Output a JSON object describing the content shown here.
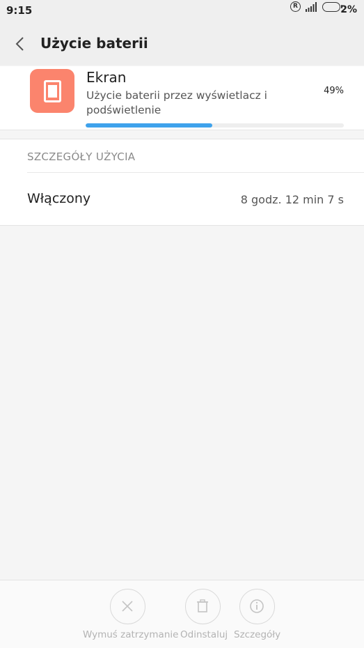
{
  "status_bar": {
    "time": "9:15",
    "registered_mark": "R",
    "battery_percent": "2%"
  },
  "action_bar": {
    "title": "Użycie baterii",
    "back_icon": "chevron-left-icon"
  },
  "app_card": {
    "name": "Ekran",
    "description": "Użycie baterii przez wyświetlacz i podświetlenie",
    "percent_label": "49%",
    "usage_fraction": 0.49,
    "icon": "phone-screen-icon",
    "icon_color": "#fb846d",
    "progress_color": "#3ea2ec"
  },
  "details": {
    "header": "SZCZEGÓŁY UŻYCIA",
    "rows": [
      {
        "label": "Włączony",
        "value": "8 godz. 12 min 7 s"
      }
    ]
  },
  "bottom_actions": [
    {
      "label": "Wymuś zatrzymanie",
      "icon": "close-icon"
    },
    {
      "label": "Odinstaluj",
      "icon": "trash-icon"
    },
    {
      "label": "Szczegóły",
      "icon": "info-icon"
    }
  ]
}
